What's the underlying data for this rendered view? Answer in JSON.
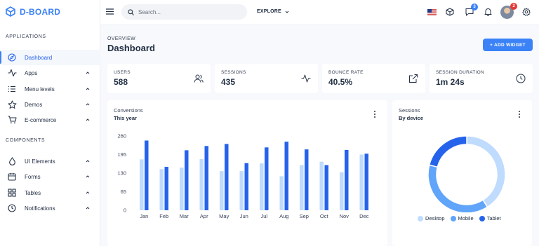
{
  "brand": {
    "name": "D-BOARD"
  },
  "sidebar": {
    "sections": [
      "APPLICATIONS",
      "COMPONENTS"
    ],
    "items": [
      {
        "label": "Dashboard",
        "icon": "compass-icon",
        "active": true
      },
      {
        "label": "Apps",
        "icon": "activity-icon"
      },
      {
        "label": "Menu levels",
        "icon": "list-icon"
      },
      {
        "label": "Demos",
        "icon": "star-icon"
      },
      {
        "label": "E-commerce",
        "icon": "cart-icon"
      },
      {
        "label": "UI Elements",
        "icon": "droplet-icon"
      },
      {
        "label": "Forms",
        "icon": "calendar-icon"
      },
      {
        "label": "Tables",
        "icon": "grid-icon"
      },
      {
        "label": "Notifications",
        "icon": "clock-icon"
      }
    ]
  },
  "topbar": {
    "search_placeholder": "Search...",
    "explore_label": "EXPLORE",
    "messages_badge": "3",
    "avatar_badge": "2"
  },
  "page": {
    "overline": "OVERVIEW",
    "title": "Dashboard",
    "add_widget_label": "+ ADD WIDGET"
  },
  "stats": [
    {
      "label": "USERS",
      "value": "588",
      "icon": "users-icon"
    },
    {
      "label": "SESSIONS",
      "value": "435",
      "icon": "activity-icon"
    },
    {
      "label": "BOUNCE RATE",
      "value": "40.5%",
      "icon": "external-link-icon"
    },
    {
      "label": "SESSION DURATION",
      "value": "1m 24s",
      "icon": "clock-icon"
    }
  ],
  "conversions_card": {
    "title": "Conversions",
    "subtitle": "This year"
  },
  "sessions_card": {
    "title": "Sessions",
    "subtitle": "By device"
  },
  "colors": {
    "accent": "#3b82f6",
    "dark_blue": "#2563eb",
    "light_blue": "#bfdbfe",
    "mid_blue": "#60a5fa"
  },
  "chart_data": [
    {
      "type": "bar",
      "categories": [
        "Jan",
        "Feb",
        "Mar",
        "Apr",
        "May",
        "Jun",
        "Jul",
        "Aug",
        "Sep",
        "Oct",
        "Nov",
        "Dec"
      ],
      "y_ticks": [
        "260",
        "195",
        "130",
        "65",
        "0"
      ],
      "ylim": [
        0,
        260
      ],
      "series": [
        {
          "values": [
            178,
            144,
            149,
            179,
            137,
            137,
            164,
            119,
            158,
            170,
            133,
            195
          ]
        },
        {
          "values": [
            244,
            152,
            210,
            225,
            232,
            165,
            220,
            240,
            213,
            158,
            211,
            198
          ]
        }
      ]
    },
    {
      "type": "pie",
      "categories": [
        "Desktop",
        "Mobile",
        "Tablet"
      ],
      "values": [
        41,
        38,
        21
      ],
      "legend": "bottom"
    }
  ]
}
